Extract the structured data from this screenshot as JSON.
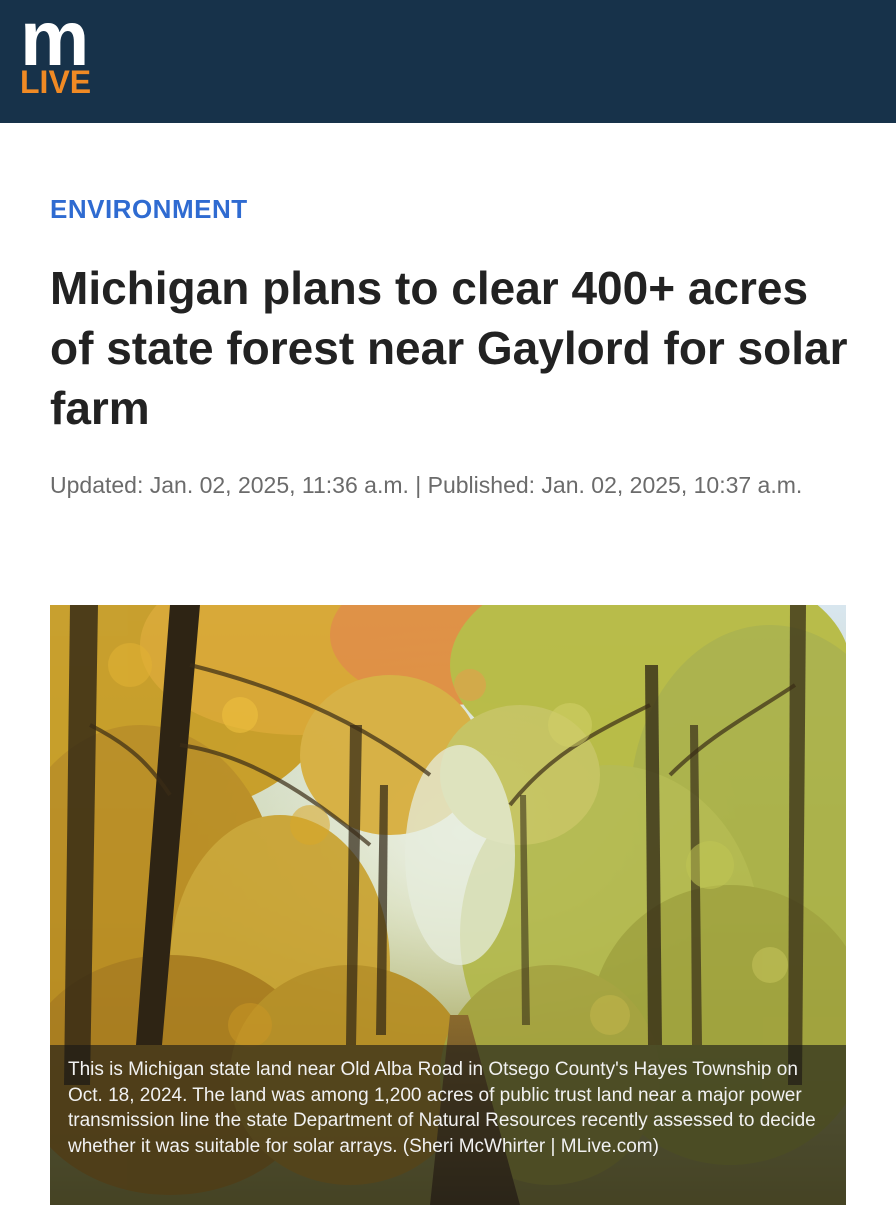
{
  "brand": {
    "logo_m": "m",
    "logo_live": "LIVE",
    "header_color": "#17324a",
    "accent_color": "#f08a24"
  },
  "article": {
    "section": "ENVIRONMENT",
    "section_color": "#2f6bd1",
    "headline": "Michigan plans to clear 400+ acres of state forest near Gaylord for solar farm",
    "dateline": "Updated: Jan. 02, 2025, 11:36 a.m. | Published: Jan. 02, 2025, 10:37 a.m.",
    "photo": {
      "icon": "forest-photo",
      "caption": "This is Michigan state land near Old Alba Road in Otsego County's Hayes Township on Oct. 18, 2024. The land was among 1,200 acres of public trust land near a major power transmission line the state Department of Natural Resources recently assessed to decide whether it was suitable for solar arrays. (Sheri McWhirter | MLive.com)"
    }
  }
}
